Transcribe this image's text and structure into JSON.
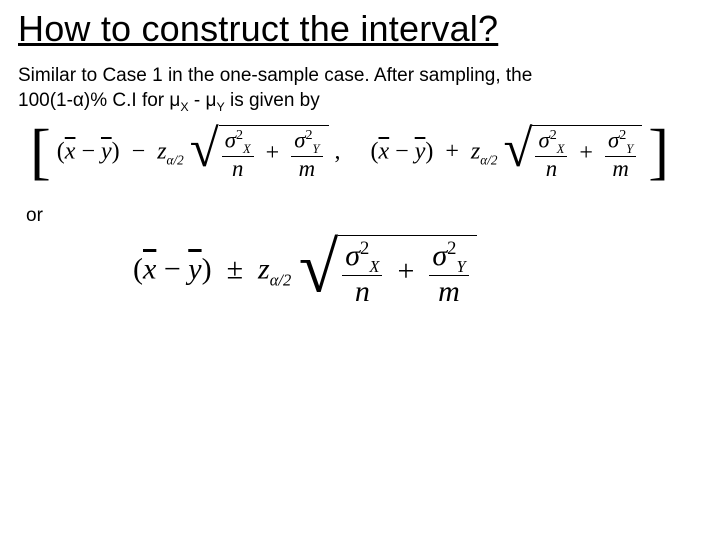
{
  "title": "How to construct the interval?",
  "intro_line1": "Similar to Case 1 in the one-sample case. After sampling, the",
  "intro_ci_prefix": "100(1-α)% C.I for μ",
  "intro_sub_x": "X",
  "intro_mid": " - μ",
  "intro_sub_y": "Y",
  "intro_suffix": " is given by",
  "or_label": "or",
  "sym": {
    "xbar": "x",
    "ybar": "y",
    "z": "z",
    "alpha_half": "α/2",
    "sigma": "σ",
    "X": "X",
    "Y": "Y",
    "two": "2",
    "n": "n",
    "m": "m",
    "lbr": "[",
    "rbr": "]",
    "comma": ",",
    "plusminus": "±",
    "plus": "+",
    "minus": "−",
    "lpar": "(",
    "rpar": ")"
  }
}
